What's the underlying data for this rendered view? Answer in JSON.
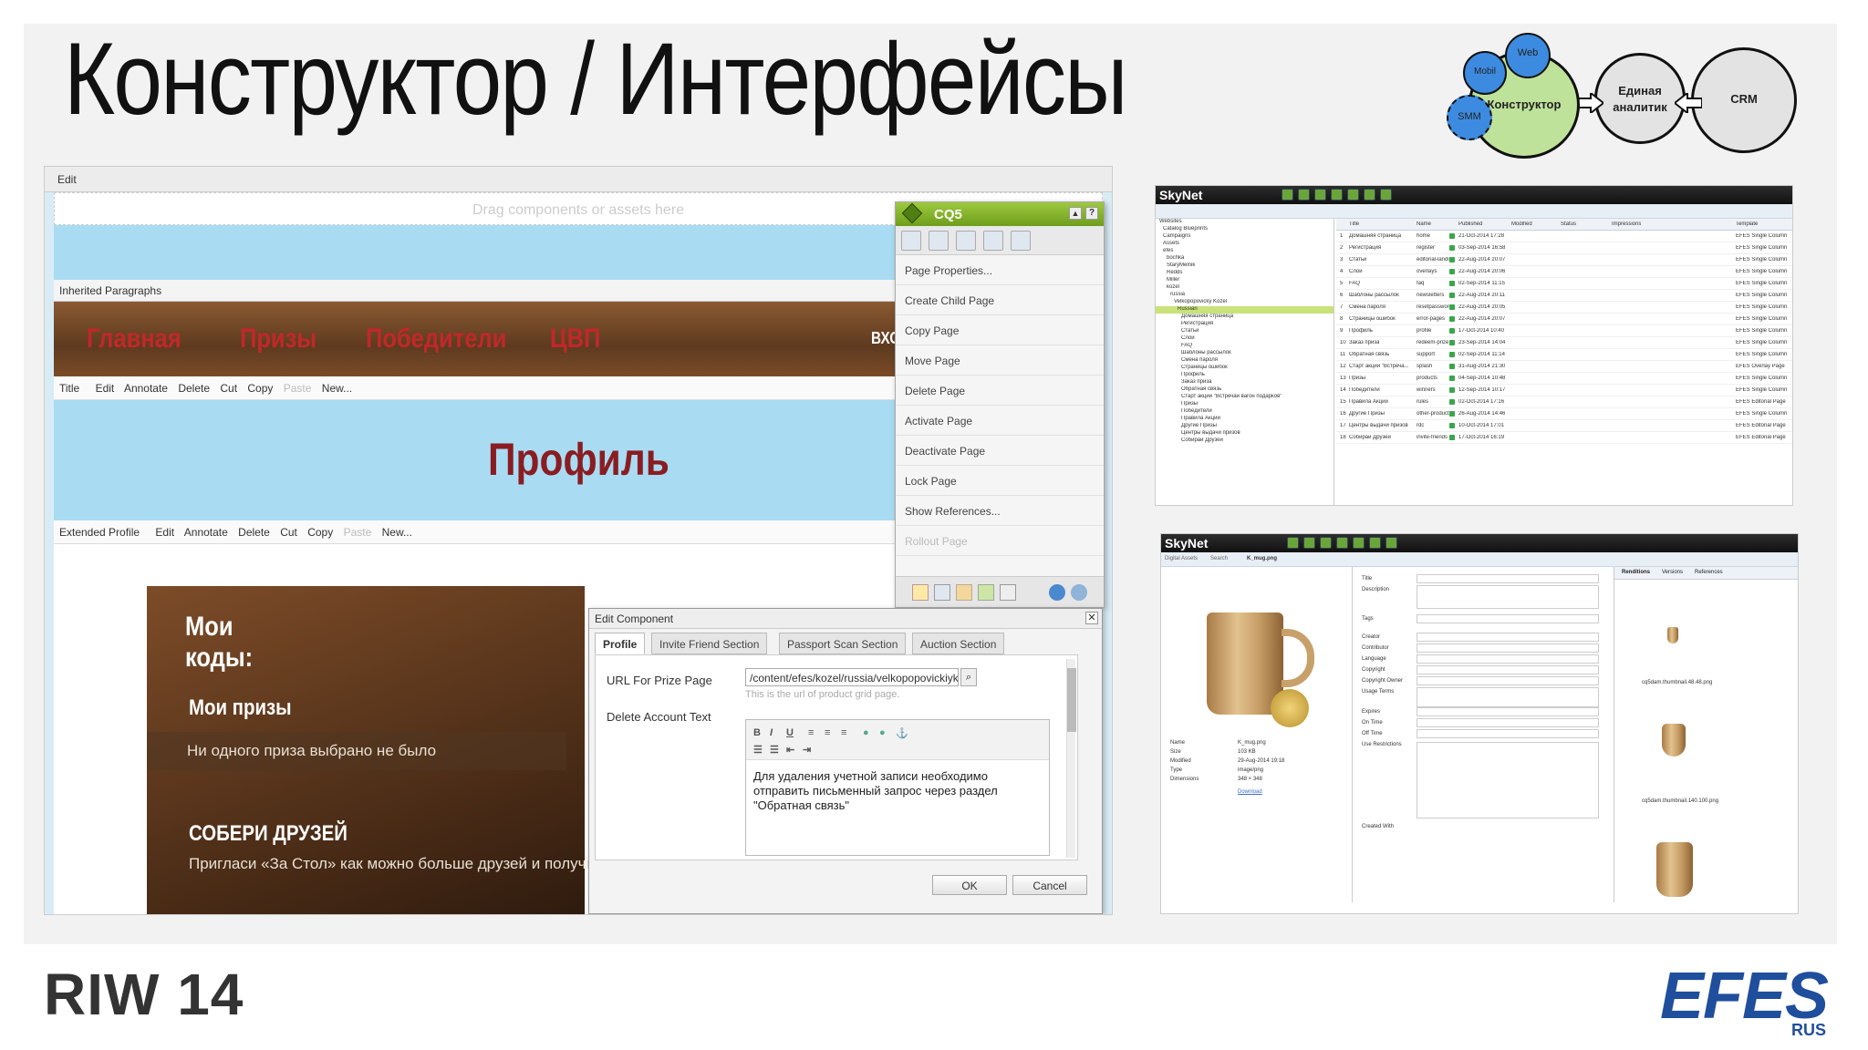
{
  "slide": {
    "title": "Конструктор / Интерфейсы",
    "footer_logo": "RIW 14",
    "brand": "EFES",
    "brand_sub": "RUS"
  },
  "diagram": {
    "nodes": [
      "Web",
      "Mobil",
      "SMM",
      "Конструктор",
      "Единая аналитик",
      "CRM"
    ],
    "colors": {
      "blue": "#3d8be0",
      "green": "#bfe29b",
      "grey": "#e3e3e3"
    }
  },
  "cq_editor": {
    "edit_label": "Edit",
    "drop_hint": "Drag components or assets here",
    "inherited_label": "Inherited Paragraphs",
    "nav_items": [
      "Главная",
      "Призы",
      "Победители",
      "ЦВП",
      "ВХО"
    ],
    "toolbar1": {
      "title": "Title",
      "items": [
        "Edit",
        "Annotate",
        "Delete",
        "Cut",
        "Copy",
        "Paste",
        "New..."
      ]
    },
    "profile_heading": "Профиль",
    "toolbar2": {
      "title": "Extended Profile",
      "items": [
        "Edit",
        "Annotate",
        "Delete",
        "Cut",
        "Copy",
        "Paste",
        "New..."
      ]
    },
    "content": {
      "codes_title": "Мои коды:",
      "prizes_title": "Мои призы",
      "no_prize": "Ни одного приза выбрано не было",
      "friends_title": "СОБЕРИ ДРУЗЕЙ",
      "friends_text": "Пригласи «За Стол» как можно больше друзей и получи"
    }
  },
  "sidekick": {
    "title": "CQ5",
    "items": [
      "Page Properties...",
      "Create Child Page",
      "Copy Page",
      "Move Page",
      "Delete Page",
      "Activate Page",
      "Deactivate Page",
      "Lock Page",
      "Show References...",
      "Rollout Page"
    ]
  },
  "dialog": {
    "title": "Edit Component",
    "tabs": [
      "Profile",
      "Invite Friend Section",
      "Passport Scan Section",
      "Auction Section"
    ],
    "url_label": "URL For Prize Page",
    "url_value": "/content/efes/kozel/russia/velkopopovickiykozel/ru/",
    "url_hint": "This is the url of product grid page.",
    "delete_label": "Delete Account Text",
    "delete_text": "Для удаления учетной записи необходимо отправить письменный запрос через раздел \"Обратная связь\"",
    "ok": "OK",
    "cancel": "Cancel"
  },
  "skynet1": {
    "logo": "SkyNet",
    "tree": [
      "Websites",
      "Catalog Blueprints",
      "Campaigns",
      "Assets",
      "efes",
      "bochka",
      "StaryMelnik",
      "Redds",
      "Miller",
      "kozel",
      "russia",
      "Velkopopovicky Kozel",
      "Russian",
      "Домашняя страница",
      "Регистрация",
      "Статьи",
      "Слои",
      "FAQ",
      "Шаблоны рассылок",
      "Смена пароля",
      "Страницы ошибок",
      "Профиль",
      "Заказ приза",
      "Обратная связь",
      "Старт акции \"Встречай вагон подарков\"",
      "Призы",
      "Победители",
      "Правила Акции",
      "Другие Призы",
      "Центры выдачи призов",
      "Собирай Друзей"
    ],
    "columns": [
      "Title",
      "Name",
      "Published",
      "Modified",
      "Status",
      "Impressions",
      "Template"
    ],
    "rows": [
      [
        "1",
        "Домашняя страница",
        "home",
        "21-Oct-2014 17:28",
        "EFES Single Column"
      ],
      [
        "2",
        "Регистрация",
        "register",
        "03-Sep-2014 16:58",
        "EFES Single Column"
      ],
      [
        "3",
        "Статьи",
        "editorial-landing",
        "22-Aug-2014 20:07",
        "EFES Single Column"
      ],
      [
        "4",
        "Слои",
        "overlays",
        "22-Aug-2014 20:06",
        "EFES Single Column"
      ],
      [
        "5",
        "FAQ",
        "faq",
        "02-Sep-2014 11:15",
        "EFES Single Column"
      ],
      [
        "6",
        "Шаблоны рассылок",
        "newsletters",
        "22-Aug-2014 20:11",
        "EFES Single Column"
      ],
      [
        "7",
        "Смена пароля",
        "resetpassword",
        "22-Aug-2014 20:05",
        "EFES Single Column"
      ],
      [
        "8",
        "Страницы ошибок",
        "error-pages",
        "22-Aug-2014 20:07",
        "EFES Single Column"
      ],
      [
        "9",
        "Профиль",
        "profile",
        "17-Oct-2014 10:40",
        "EFES Single Column"
      ],
      [
        "10",
        "Заказ приза",
        "redeem-prize",
        "23-Sep-2014 14:04",
        "EFES Single Column"
      ],
      [
        "11",
        "Обратная связь",
        "support",
        "02-Sep-2014 11:14",
        "EFES Single Column"
      ],
      [
        "12",
        "Старт акции \"Встреча...",
        "splash",
        "31-Aug-2014 21:30",
        "EFES Overlay Page"
      ],
      [
        "13",
        "Призы",
        "products",
        "04-Sep-2014 10:48",
        "EFES Single Column"
      ],
      [
        "14",
        "Победители",
        "winners",
        "12-Sep-2014 10:17",
        "EFES Single Column"
      ],
      [
        "15",
        "Правила Акции",
        "rules",
        "02-Oct-2014 17:16",
        "EFES Editorial Page"
      ],
      [
        "16",
        "Другие Призы",
        "other-products",
        "26-Aug-2014 14:46",
        "EFES Single Column"
      ],
      [
        "17",
        "Центры выдачи призов",
        "rdc",
        "10-Oct-2014 17:01",
        "EFES Editorial Page"
      ],
      [
        "18",
        "Собирай Друзей",
        "invite-friends",
        "17-Oct-2014 16:19",
        "EFES Editorial Page"
      ]
    ]
  },
  "skynet2": {
    "logo": "SkyNet",
    "tabs": [
      "Digital Assets",
      "Search",
      "K_mug.png"
    ],
    "file_meta": [
      [
        "Name",
        "K_mug.png"
      ],
      [
        "Size",
        "103 KB"
      ],
      [
        "Modified",
        "29-Aug-2014 19:18"
      ],
      [
        "Type",
        "image/png"
      ],
      [
        "Dimensions",
        "348 × 348"
      ]
    ],
    "download": "Download",
    "fields": [
      "Title",
      "Description",
      "Tags",
      "Creator",
      "Contributor",
      "Language",
      "Copyright",
      "Copyright Owner",
      "Usage Terms",
      "Expires",
      "On Time",
      "Off Time",
      "Use Restrictions",
      "Created With"
    ],
    "right_tabs": [
      "Renditions",
      "Versions",
      "References"
    ],
    "renditions": [
      "cq5dam.thumbnail.48.48.png",
      "cq5dam.thumbnail.140.100.png"
    ]
  }
}
